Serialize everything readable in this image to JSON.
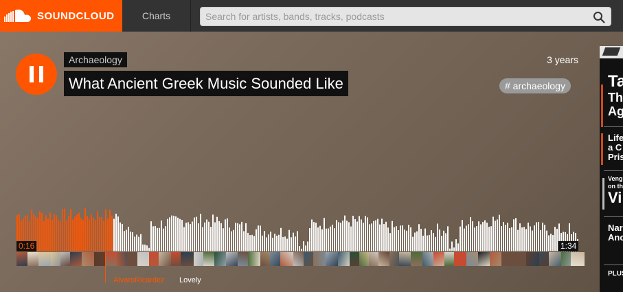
{
  "header": {
    "brand": "SOUNDCLOUD",
    "nav_charts": "Charts",
    "search_placeholder": "Search for artists, bands, tracks, podcasts"
  },
  "track": {
    "user": "Archaeology",
    "title": "What Ancient Greek Music Sounded Like",
    "posted_ago": "3 years",
    "tag": "# archaeology",
    "is_playing": true
  },
  "playback": {
    "current_time": "0:16",
    "total_time": "1:34",
    "progress_fraction": 0.17
  },
  "comment": {
    "user": "AlvaroRicardez",
    "text": "Lovely"
  },
  "ad": {
    "lines": [
      "Ta",
      "Thr",
      "Ag",
      "Life",
      "a C",
      "Pris",
      "Veng",
      "on th",
      "th",
      "Vi",
      "Nar",
      "Anc",
      "PLUS:"
    ]
  },
  "colors": {
    "accent": "#ff5500",
    "header_bg": "#333333",
    "tag_bg": "#9a9a9a"
  }
}
